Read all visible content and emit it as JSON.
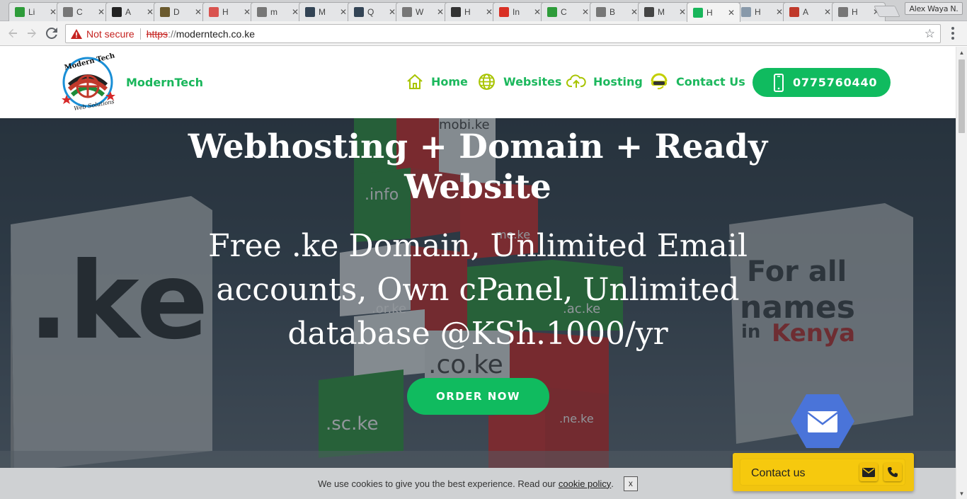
{
  "browser": {
    "tabs": [
      {
        "title": "Li",
        "icon": "leaf-icon",
        "color": "#2e9c3a"
      },
      {
        "title": "C",
        "icon": "page-icon",
        "color": "#777777"
      },
      {
        "title": "A",
        "icon": "dark-square-icon",
        "color": "#222222"
      },
      {
        "title": "D",
        "icon": "photo-icon",
        "color": "#6b5a2e"
      },
      {
        "title": "H",
        "icon": "colorful-icon",
        "color": "#d9534f"
      },
      {
        "title": "m",
        "icon": "page-icon",
        "color": "#777777"
      },
      {
        "title": "M",
        "icon": "server-icon",
        "color": "#334455"
      },
      {
        "title": "Q",
        "icon": "server-icon",
        "color": "#334455"
      },
      {
        "title": "W",
        "icon": "page-icon",
        "color": "#777777"
      },
      {
        "title": "H",
        "icon": "circle-logo-icon",
        "color": "#333333"
      },
      {
        "title": "In",
        "icon": "gmail-icon",
        "color": "#d93025"
      },
      {
        "title": "C",
        "icon": "leaf-icon",
        "color": "#2e9c3a"
      },
      {
        "title": "B",
        "icon": "page-icon",
        "color": "#777777"
      },
      {
        "title": "M",
        "icon": "avatar-icon",
        "color": "#444444"
      },
      {
        "title": "H",
        "icon": "moderntech-icon",
        "color": "#19b65b"
      },
      {
        "title": "H",
        "icon": "globe-icon",
        "color": "#8899aa"
      },
      {
        "title": "A",
        "icon": "flag-icon",
        "color": "#c0392b"
      },
      {
        "title": "H",
        "icon": "page-icon",
        "color": "#777777"
      }
    ],
    "active_tab_index": 14,
    "profile_name": "Alex Waya N.",
    "security_label": "Not secure",
    "url_scheme": "https",
    "url_sep": "://",
    "url_host": "moderntech.co.ke"
  },
  "header": {
    "brand": "ModernTech",
    "logo_text_top": "Modern Tech",
    "logo_text_bottom": "Web Solutions",
    "nav": [
      {
        "label": "Home",
        "icon": "home-icon"
      },
      {
        "label": "Websites",
        "icon": "globe-icon"
      },
      {
        "label": "Hosting",
        "icon": "cloud-upload-icon"
      },
      {
        "label": "Contact Us",
        "icon": "headset-icon"
      }
    ],
    "phone": "0775760440"
  },
  "hero": {
    "title": "Webhosting + Domain + Ready Website",
    "subtitle": "Free .ke Domain, Unlimited Email accounts, Own cPanel, Unlimited database @KSh.1000/yr",
    "cta": "ORDER NOW",
    "bg_text": {
      "ke": ".ke",
      "for_all": "For all",
      "names": "names",
      "in": "in",
      "kenya": "Kenya",
      "domains": [
        ".info",
        "mobi.ke",
        "me.ke",
        ".or.ke",
        ".ac.ke",
        ".co.ke",
        ".sc.ke",
        ".ne.ke"
      ]
    }
  },
  "cookie": {
    "text": "We use cookies to give you the best experience. Read our",
    "link": "cookie policy",
    "after": ".",
    "close": "x"
  },
  "contact_widget": {
    "label": "Contact us"
  },
  "colors": {
    "brand_green": "#19b65b",
    "button_green": "#10bb5f",
    "widget_yellow": "#f1c40f",
    "hex_blue": "#4a74d9"
  }
}
